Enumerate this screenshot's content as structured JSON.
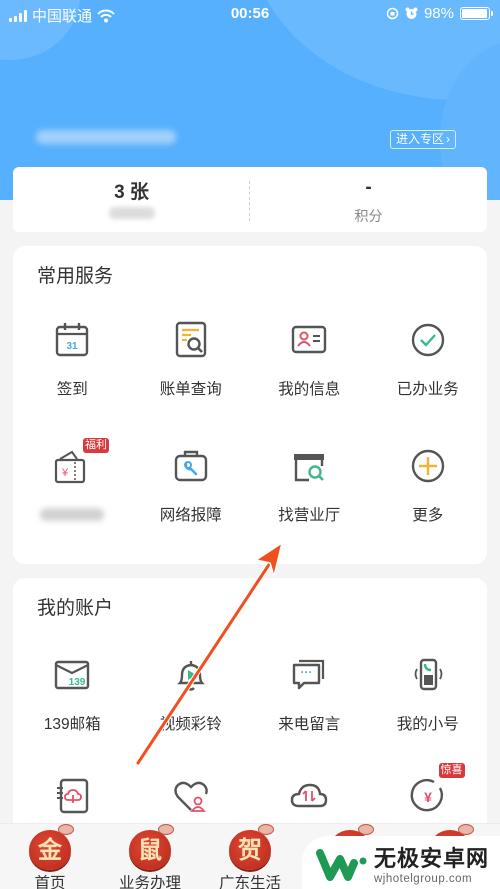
{
  "status_bar": {
    "carrier": "中国联通",
    "time": "00:56",
    "battery_percent": "98%",
    "battery_level": 0.98
  },
  "header": {
    "enter_zone_label": "进入专区",
    "enter_zone_chevron": "›"
  },
  "summary": {
    "left_value": "3 张",
    "right_value": "-",
    "right_label": "积分"
  },
  "common_services": {
    "title": "常用服务",
    "items": [
      {
        "label": "签到",
        "icon": "calendar-icon",
        "calendar_day": "31"
      },
      {
        "label": "账单查询",
        "icon": "bill-search-icon"
      },
      {
        "label": "我的信息",
        "icon": "id-card-icon"
      },
      {
        "label": "已办业务",
        "icon": "check-circle-icon"
      },
      {
        "label": "",
        "icon": "coupon-icon",
        "badge": "福利",
        "currency": "¥"
      },
      {
        "label": "网络报障",
        "icon": "repair-toolbox-icon"
      },
      {
        "label": "找营业厅",
        "icon": "store-search-icon"
      },
      {
        "label": "更多",
        "icon": "plus-circle-icon"
      }
    ]
  },
  "my_account": {
    "title": "我的账户",
    "items": [
      {
        "label": "139邮箱",
        "icon": "mail-139-icon",
        "mail_number": "139"
      },
      {
        "label": "视频彩铃",
        "icon": "video-ringtone-bell-icon"
      },
      {
        "label": "来电留言",
        "icon": "chat-bubbles-icon",
        "dots": "···"
      },
      {
        "label": "我的小号",
        "icon": "sub-number-phone-icon"
      },
      {
        "label": "",
        "icon": "cloud-notebook-icon"
      },
      {
        "label": "",
        "icon": "family-heart-icon"
      },
      {
        "label": "",
        "icon": "cloud-transfer-icon"
      },
      {
        "label": "",
        "icon": "yuan-coin-icon",
        "badge": "惊喜",
        "currency": "¥"
      }
    ]
  },
  "tabbar": {
    "tabs": [
      {
        "label": "首页",
        "glyph": "金"
      },
      {
        "label": "业务办理",
        "glyph": "鼠"
      },
      {
        "label": "广东生活",
        "glyph": "贺"
      },
      {
        "label": "",
        "glyph": ""
      },
      {
        "label": "",
        "glyph": ""
      }
    ]
  },
  "watermark": {
    "name_cn": "无极安卓网",
    "domain": "wjhotelgroup.com"
  },
  "colors": {
    "header_blue": "#57b0fd",
    "annotation_arrow": "#f0501e",
    "badge_red": "#d8393c",
    "icon_gray": "#555555",
    "accent_green": "#3cb88a",
    "accent_blue": "#4aa8e8",
    "accent_orange": "#f5b133",
    "accent_pink": "#e4506a"
  }
}
